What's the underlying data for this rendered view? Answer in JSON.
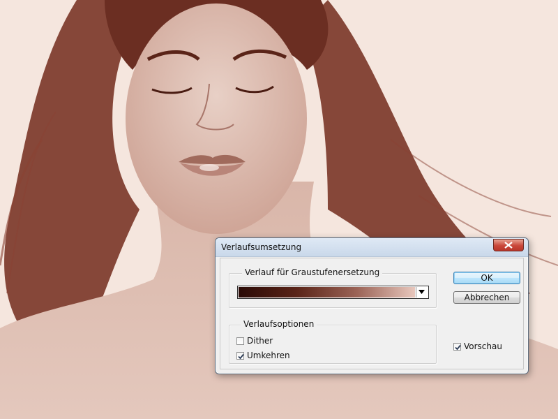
{
  "dialog": {
    "title": "Verlaufsumsetzung",
    "gradient_group_label": "Verlauf für Graustufenersetzung",
    "gradient_colors": [
      "#2a0a06",
      "#5a2418",
      "#9b6356",
      "#e8c7bd"
    ],
    "options_group_label": "Verlaufsoptionen",
    "dither": {
      "label": "Dither",
      "checked": false
    },
    "reverse": {
      "label": "Umkehren",
      "checked": true
    },
    "ok_label": "OK",
    "cancel_label": "Abbrechen",
    "preview": {
      "label": "Vorschau",
      "checked": true
    }
  },
  "colors": {
    "photo_background": "#f3e2da",
    "hair": "#6b2e22",
    "skin": "#dcbcb0",
    "close_button": "#c9473a",
    "default_button_border": "#3c7fb1"
  }
}
